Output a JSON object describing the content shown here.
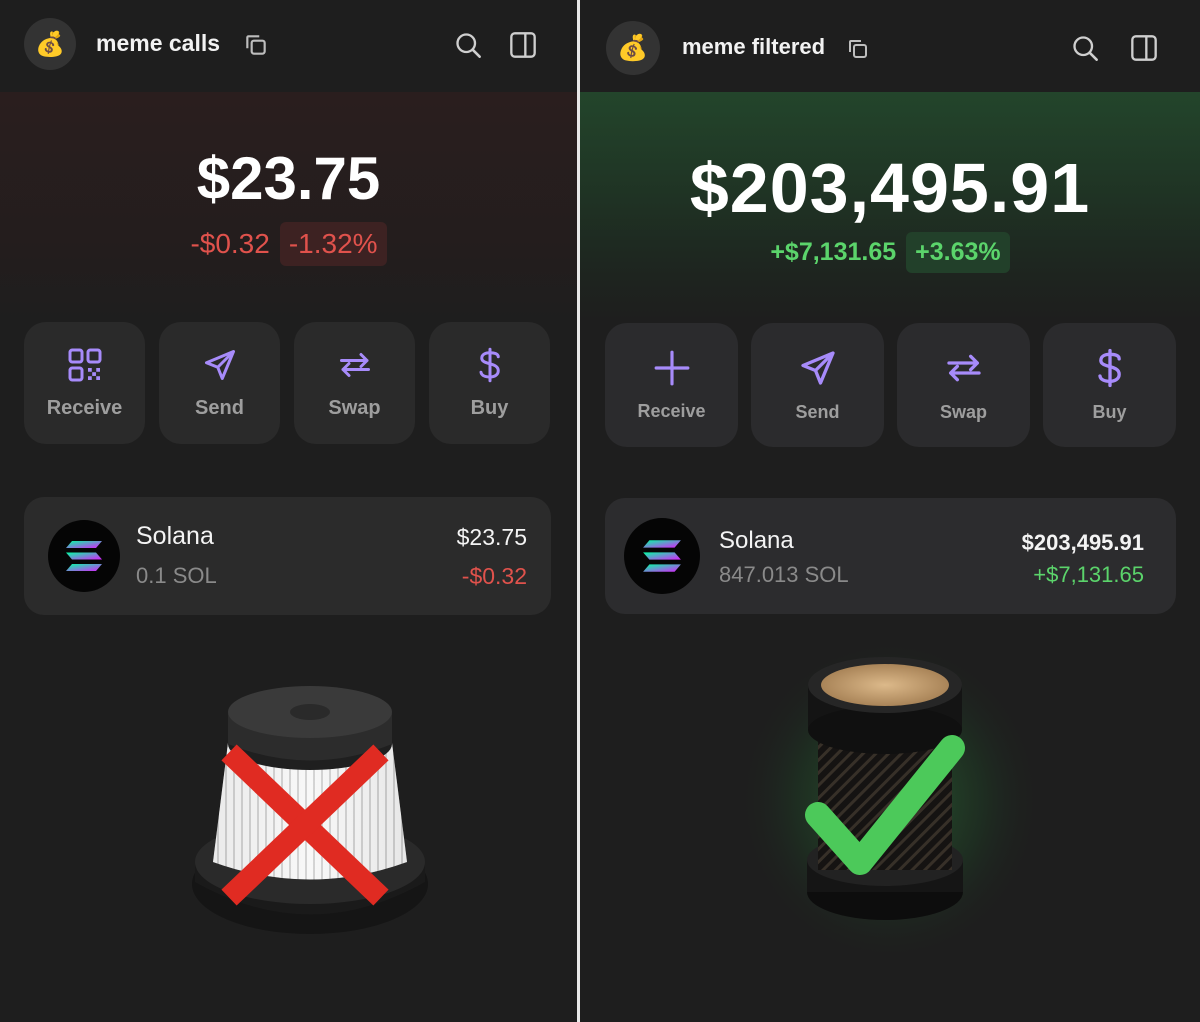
{
  "left": {
    "wallet": {
      "avatar_emoji": "💰",
      "name": "meme calls"
    },
    "header_icons": [
      "copy-icon",
      "search-icon",
      "sidebar-icon"
    ],
    "balance": "$23.75",
    "change": {
      "amount": "-$0.32",
      "percent": "-1.32%",
      "color": "#e0524c",
      "pill_bg": "#3d2222"
    },
    "actions": [
      {
        "label": "Receive",
        "icon": "qr-code-icon"
      },
      {
        "label": "Send",
        "icon": "send-icon"
      },
      {
        "label": "Swap",
        "icon": "swap-icon"
      },
      {
        "label": "Buy",
        "icon": "dollar-icon"
      }
    ],
    "token": {
      "name": "Solana",
      "amount": "0.1 SOL",
      "value": "$23.75",
      "change": "-$0.32"
    },
    "illustration": {
      "icon": "filter-icon",
      "overlay": "red-x-icon"
    }
  },
  "right": {
    "wallet": {
      "avatar_emoji": "💰",
      "name": "meme filtered"
    },
    "header_icons": [
      "copy-icon",
      "search-icon",
      "sidebar-icon"
    ],
    "balance": "$203,495.91",
    "change": {
      "amount": "+$7,131.65",
      "percent": "+3.63%",
      "color": "#5bd46b",
      "pill_bg": "#22402a"
    },
    "actions": [
      {
        "label": "Receive",
        "icon": "plus-icon"
      },
      {
        "label": "Send",
        "icon": "send-icon"
      },
      {
        "label": "Swap",
        "icon": "swap-icon"
      },
      {
        "label": "Buy",
        "icon": "dollar-icon"
      }
    ],
    "token": {
      "name": "Solana",
      "amount": "847.013 SOL",
      "value": "$203,495.91",
      "change": "+$7,131.65"
    },
    "illustration": {
      "icon": "filter-icon",
      "overlay": "green-check-icon"
    }
  },
  "colors": {
    "accent": "#a78bfa",
    "negative": "#e0524c",
    "positive": "#5bd46b"
  }
}
